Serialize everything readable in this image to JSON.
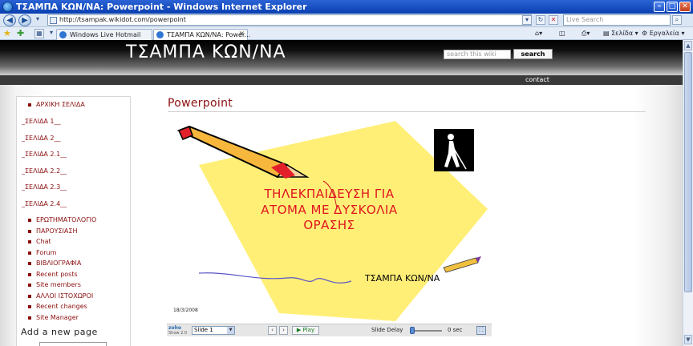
{
  "browser": {
    "window_title": "ΤΣΑΜΠΑ ΚΩΝ/ΝΑ: Powerpoint - Windows Internet Explorer",
    "url": "http://tsampak.wikidot.com/powerpoint",
    "live_search_placeholder": "Live Search",
    "tabs": [
      {
        "label": "Windows Live Hotmail"
      },
      {
        "label": "ΤΣΑΜΠΑ ΚΩΝ/ΝΑ: Power..."
      }
    ],
    "toolbar": {
      "page_menu": "Σελίδα",
      "tools_menu": "Εργαλεία"
    }
  },
  "site": {
    "title": "ΤΣΑΜΠΑ ΚΩΝ/ΝΑ",
    "search_placeholder": "search this wiki",
    "search_button": "search",
    "contact": "contact"
  },
  "sidebar": {
    "home": "ΑΡΧΙΚΗ ΣΕΛΙΔΑ",
    "sections": [
      "_ΣΕΛΙΔΑ 1__",
      "_ΣΕΛΙΔΑ 2__",
      "_ΣΕΛΙΔΑ 2.1__",
      "_ΣΕΛΙΔΑ 2.2__",
      "_ΣΕΛΙΔΑ 2.3__",
      "_ΣΕΛΙΔΑ 2.4__"
    ],
    "links": [
      "ΕΡΩΤΗΜΑΤΟΛΟΓΙΟ",
      "ΠΑΡΟΥΣΙΑΣΗ",
      "Chat",
      "Forum",
      "ΒΙΒΛΙΟΓΡΑΦΙΑ",
      "Recent posts",
      "Site members",
      "ΑΛΛΟΙ ΙΣΤΟΧΩΡΟΙ",
      "Recent changes",
      "Site Manager"
    ],
    "add_page": "Add a new page"
  },
  "main": {
    "page_title": "Powerpoint",
    "slide": {
      "lines": [
        "ΤΗΛΕΚΠΑΙΔΕΥΣΗ ΓΙΑ",
        "ΑΤΟΜΑ ΜΕ ΔΥΣΚΟΛΙΑ",
        "ΟΡΑΣΗΣ"
      ],
      "author": "ΤΣΑΜΠΑ ΚΩΝ/ΝΑ",
      "date": "18/3/2008"
    },
    "player": {
      "logo": "zoho",
      "logo_sub": "Show 2.0",
      "slide_select": "Slide 1",
      "play": "▶ Play",
      "delay_label": "Slide Delay",
      "delay_value": "0 sec"
    }
  }
}
